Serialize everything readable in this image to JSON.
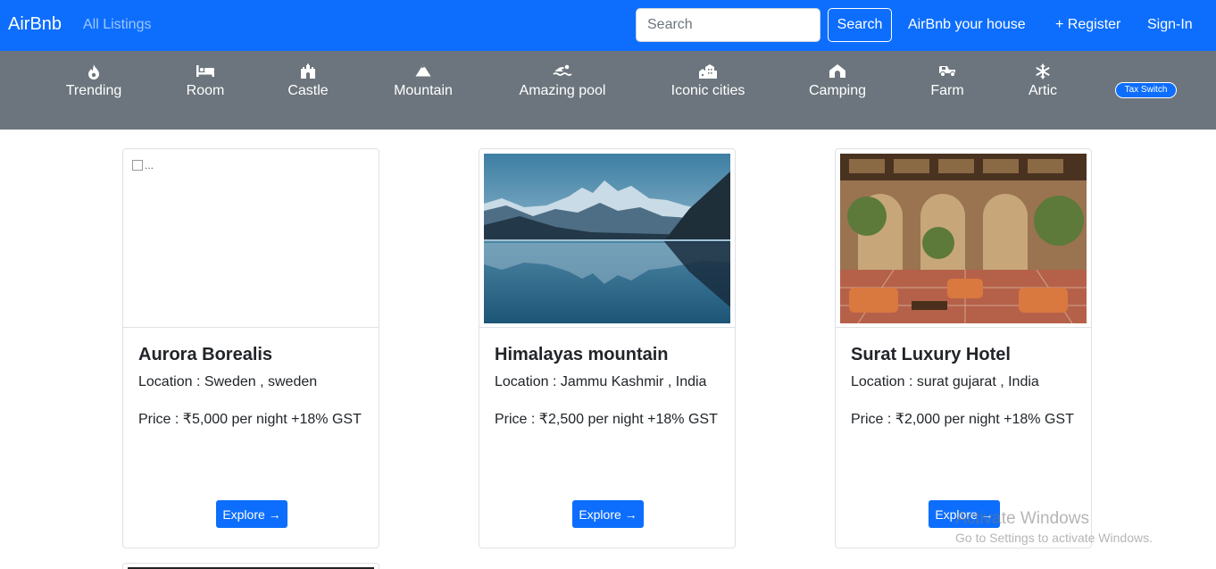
{
  "navbar": {
    "brand": "AirBnb",
    "all_listings": "All Listings",
    "search_placeholder": "Search",
    "search_button": "Search",
    "host_link": "AirBnb your house",
    "register": "+ Register",
    "signin": "Sign-In",
    "color": "#0d6efd"
  },
  "filters": {
    "items": [
      {
        "label": "Trending",
        "icon": "fire-icon"
      },
      {
        "label": "Room",
        "icon": "bed-icon"
      },
      {
        "label": "Castle",
        "icon": "castle-icon"
      },
      {
        "label": "Mountain",
        "icon": "mountain-icon"
      },
      {
        "label": "Amazing pool",
        "icon": "swimmer-icon"
      },
      {
        "label": "Iconic cities",
        "icon": "city-icon"
      },
      {
        "label": "Camping",
        "icon": "tent-icon"
      },
      {
        "label": "Farm",
        "icon": "tractor-icon"
      },
      {
        "label": "Artic",
        "icon": "snowflake-icon"
      }
    ],
    "tax_switch": "Tax Switch",
    "background": "#6c757d"
  },
  "listings": [
    {
      "title": "Aurora Borealis",
      "location": "Location : Sweden , sweden",
      "price": "Price : ₹5,000 per night +18% GST",
      "image_alt": "...",
      "explore": "Explore →"
    },
    {
      "title": "Himalayas mountain",
      "location": "Location : Jammu Kashmir , India",
      "price": "Price : ₹2,500 per night +18% GST",
      "explore": "Explore →"
    },
    {
      "title": "Surat Luxury Hotel",
      "location": "Location : surat gujarat , India",
      "price": "Price : ₹2,000 per night +18% GST",
      "explore": "Explore →"
    }
  ],
  "watermark": {
    "line1": "Activate Windows",
    "line2": "Go to Settings to activate Windows."
  }
}
